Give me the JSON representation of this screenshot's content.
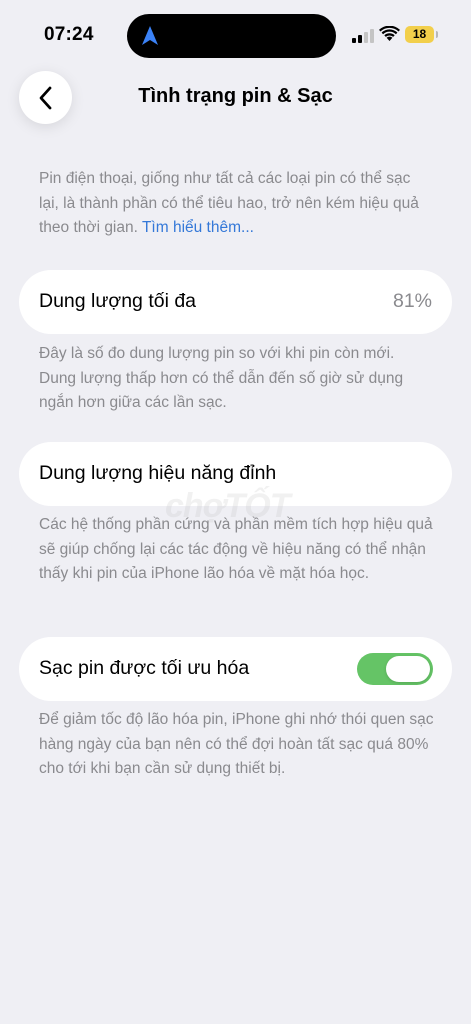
{
  "status_bar": {
    "time": "07:24",
    "battery_level": "18",
    "signal_bars_active": 2,
    "signal_bars_total": 4
  },
  "nav": {
    "title": "Tình trạng pin & Sạc",
    "back_icon": "chevron-left-icon"
  },
  "intro": {
    "text": "Pin điện thoại, giống như tất cả các loại pin có thể sạc lại, là thành phần có thể tiêu hao, trở nên kém hiệu quả theo thời gian. ",
    "link": "Tìm hiểu thêm..."
  },
  "max_capacity": {
    "label": "Dung lượng tối đa",
    "value": "81%",
    "description": "Đây là số đo dung lượng pin so với khi pin còn mới. Dung lượng thấp hơn có thể dẫn đến số giờ sử dụng ngắn hơn giữa các lần sạc."
  },
  "peak_performance": {
    "label": "Dung lượng hiệu năng đỉnh",
    "description": "Các hệ thống phần cứng và phần mềm tích hợp hiệu quả sẽ giúp chống lại các tác động về hiệu năng có thể nhận thấy khi pin của iPhone lão hóa về mặt hóa học."
  },
  "optimized_charging": {
    "label": "Sạc pin được tối ưu hóa",
    "enabled": true,
    "description": "Để giảm tốc độ lão hóa pin, iPhone ghi nhớ thói quen sạc hàng ngày của bạn nên có thể đợi hoàn tất sạc quá 80% cho tới khi bạn cần sử dụng thiết bị."
  },
  "watermark": "chợTỐT",
  "colors": {
    "background": "#efeff4",
    "toggle_on": "#65c466",
    "link": "#3478d8",
    "battery": "#f2cf4b",
    "secondary_text": "#8a8a8e"
  }
}
